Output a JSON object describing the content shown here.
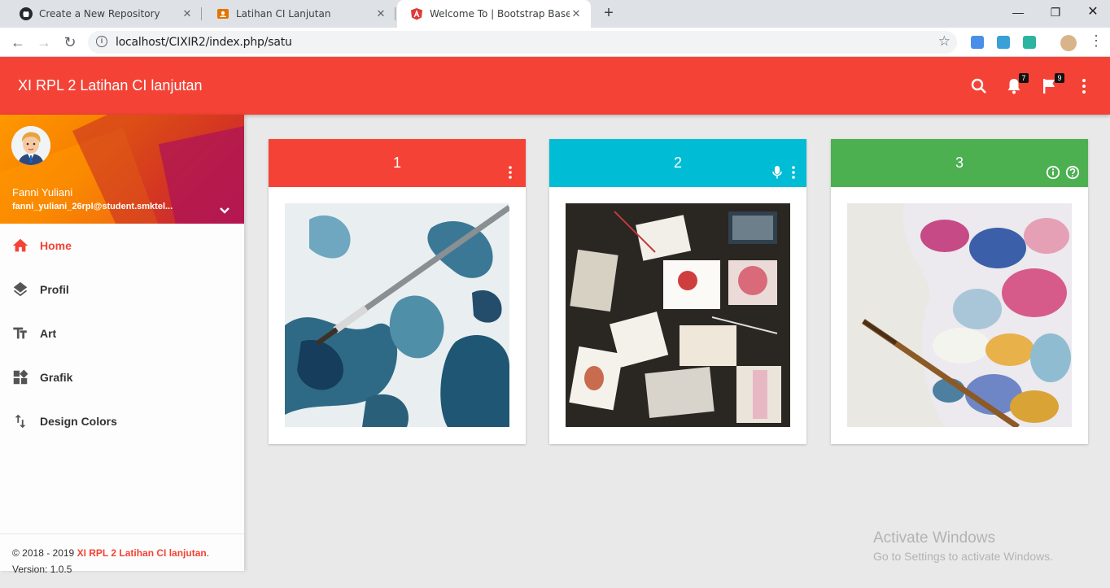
{
  "browser": {
    "tabs": [
      {
        "title": "Create a New Repository",
        "icon": "github-icon"
      },
      {
        "title": "Latihan CI Lanjutan",
        "icon": "contact-icon"
      },
      {
        "title": "Welcome To | Bootstrap Based Ad",
        "icon": "angular-icon"
      }
    ],
    "url": "localhost/CIXIR2/index.php/satu"
  },
  "app": {
    "title": "XI RPL 2 Latihan CI lanjutan",
    "notifications_count": "7",
    "tasks_count": "9",
    "accent": "#f44336"
  },
  "user": {
    "name": "Fanni Yuliani",
    "email": "fanni_yuliani_26rpl@student.smktel..."
  },
  "menu": [
    {
      "label": "Home",
      "icon": "home-icon",
      "active": true
    },
    {
      "label": "Profil",
      "icon": "layers-icon"
    },
    {
      "label": "Art",
      "icon": "text-fields-icon"
    },
    {
      "label": "Grafik",
      "icon": "widgets-icon"
    },
    {
      "label": "Design Colors",
      "icon": "swap-vert-icon"
    }
  ],
  "footer": {
    "copyright": "© 2018 - 2019 ",
    "app_link": "XI RPL 2 Latihan CI lanjutan",
    "dot": ".",
    "version": "Version: 1.0.5"
  },
  "cards": [
    {
      "title": "1",
      "color": "#f44336",
      "image": "abstract-blue-paint-image"
    },
    {
      "title": "2",
      "color": "#00bcd4",
      "image": "art-supplies-flatlay-image"
    },
    {
      "title": "3",
      "color": "#4caf50",
      "image": "paint-palette-image"
    }
  ],
  "watermark": {
    "line1": "Activate Windows",
    "line2": "Go to Settings to activate Windows."
  }
}
